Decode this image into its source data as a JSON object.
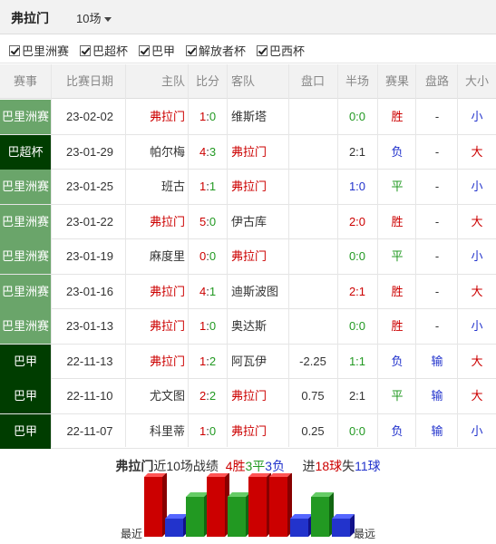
{
  "header": {
    "team": "弗拉门",
    "count_label": "10场"
  },
  "filters": [
    {
      "label": "巴里洲赛",
      "checked": true
    },
    {
      "label": "巴超杯",
      "checked": true
    },
    {
      "label": "巴甲",
      "checked": true
    },
    {
      "label": "解放者杯",
      "checked": true
    },
    {
      "label": "巴西杯",
      "checked": true
    }
  ],
  "columns": [
    "赛事",
    "比赛日期",
    "主队",
    "比分",
    "客队",
    "盘口",
    "半场",
    "赛果",
    "盘路",
    "大小"
  ],
  "colors": {
    "league_light": "#6aa56a",
    "league_dark": "#003d00",
    "win": "#cc0000",
    "draw": "#229922",
    "loss": "#2233cc"
  },
  "matches": [
    {
      "league": "巴里洲赛",
      "league_style": "light",
      "date": "23-02-02",
      "home": "弗拉门",
      "home_is_team": true,
      "score_h": "1",
      "score_a": "0",
      "away": "维斯塔",
      "away_is_team": false,
      "pan": "",
      "half": "0:0",
      "half_color": "green",
      "result": "胜",
      "pan_result": "-",
      "size": "小"
    },
    {
      "league": "巴超杯",
      "league_style": "dark",
      "date": "23-01-29",
      "home": "帕尔梅",
      "home_is_team": false,
      "score_h": "4",
      "score_a": "3",
      "away": "弗拉门",
      "away_is_team": true,
      "pan": "",
      "half": "2:1",
      "half_color": "dark",
      "result": "负",
      "pan_result": "-",
      "size": "大"
    },
    {
      "league": "巴里洲赛",
      "league_style": "light",
      "date": "23-01-25",
      "home": "班古",
      "home_is_team": false,
      "score_h": "1",
      "score_a": "1",
      "away": "弗拉门",
      "away_is_team": true,
      "pan": "",
      "half": "1:0",
      "half_color": "blue",
      "result": "平",
      "pan_result": "-",
      "size": "小"
    },
    {
      "league": "巴里洲赛",
      "league_style": "light",
      "date": "23-01-22",
      "home": "弗拉门",
      "home_is_team": true,
      "score_h": "5",
      "score_a": "0",
      "away": "伊古库",
      "away_is_team": false,
      "pan": "",
      "half": "2:0",
      "half_color": "red",
      "result": "胜",
      "pan_result": "-",
      "size": "大"
    },
    {
      "league": "巴里洲赛",
      "league_style": "light",
      "date": "23-01-19",
      "home": "麻度里",
      "home_is_team": false,
      "score_h": "0",
      "score_a": "0",
      "away": "弗拉门",
      "away_is_team": true,
      "pan": "",
      "half": "0:0",
      "half_color": "green",
      "result": "平",
      "pan_result": "-",
      "size": "小"
    },
    {
      "league": "巴里洲赛",
      "league_style": "light",
      "date": "23-01-16",
      "home": "弗拉门",
      "home_is_team": true,
      "score_h": "4",
      "score_a": "1",
      "away": "迪斯波图",
      "away_is_team": false,
      "pan": "",
      "half": "2:1",
      "half_color": "red",
      "result": "胜",
      "pan_result": "-",
      "size": "大"
    },
    {
      "league": "巴里洲赛",
      "league_style": "light",
      "date": "23-01-13",
      "home": "弗拉门",
      "home_is_team": true,
      "score_h": "1",
      "score_a": "0",
      "away": "奥达斯",
      "away_is_team": false,
      "pan": "",
      "half": "0:0",
      "half_color": "green",
      "result": "胜",
      "pan_result": "-",
      "size": "小"
    },
    {
      "league": "巴甲",
      "league_style": "dark",
      "date": "22-11-13",
      "home": "弗拉门",
      "home_is_team": true,
      "score_h": "1",
      "score_a": "2",
      "away": "阿瓦伊",
      "away_is_team": false,
      "pan": "-2.25",
      "half": "1:1",
      "half_color": "green",
      "result": "负",
      "pan_result": "输",
      "size": "大"
    },
    {
      "league": "巴甲",
      "league_style": "dark",
      "date": "22-11-10",
      "home": "尤文图",
      "home_is_team": false,
      "score_h": "2",
      "score_a": "2",
      "away": "弗拉门",
      "away_is_team": true,
      "pan": "0.75",
      "half": "2:1",
      "half_color": "dark",
      "result": "平",
      "pan_result": "输",
      "size": "大"
    },
    {
      "league": "巴甲",
      "league_style": "dark",
      "date": "22-11-07",
      "home": "科里蒂",
      "home_is_team": false,
      "score_h": "1",
      "score_a": "0",
      "away": "弗拉门",
      "away_is_team": true,
      "pan": "0.25",
      "half": "0:0",
      "half_color": "green",
      "result": "负",
      "pan_result": "输",
      "size": "小"
    }
  ],
  "summary": {
    "team": "弗拉门",
    "text_recent": "近10场战绩",
    "wins": "4胜",
    "draws": "3平",
    "losses": "3负",
    "goals_prefix": "进",
    "goals_for": "18球",
    "goals_mid": "失",
    "goals_against": "11球"
  },
  "form_chart": {
    "label_recent": "最近",
    "label_far": "最远",
    "results": [
      "胜",
      "负",
      "平",
      "胜",
      "平",
      "胜",
      "胜",
      "负",
      "平",
      "负"
    ]
  }
}
